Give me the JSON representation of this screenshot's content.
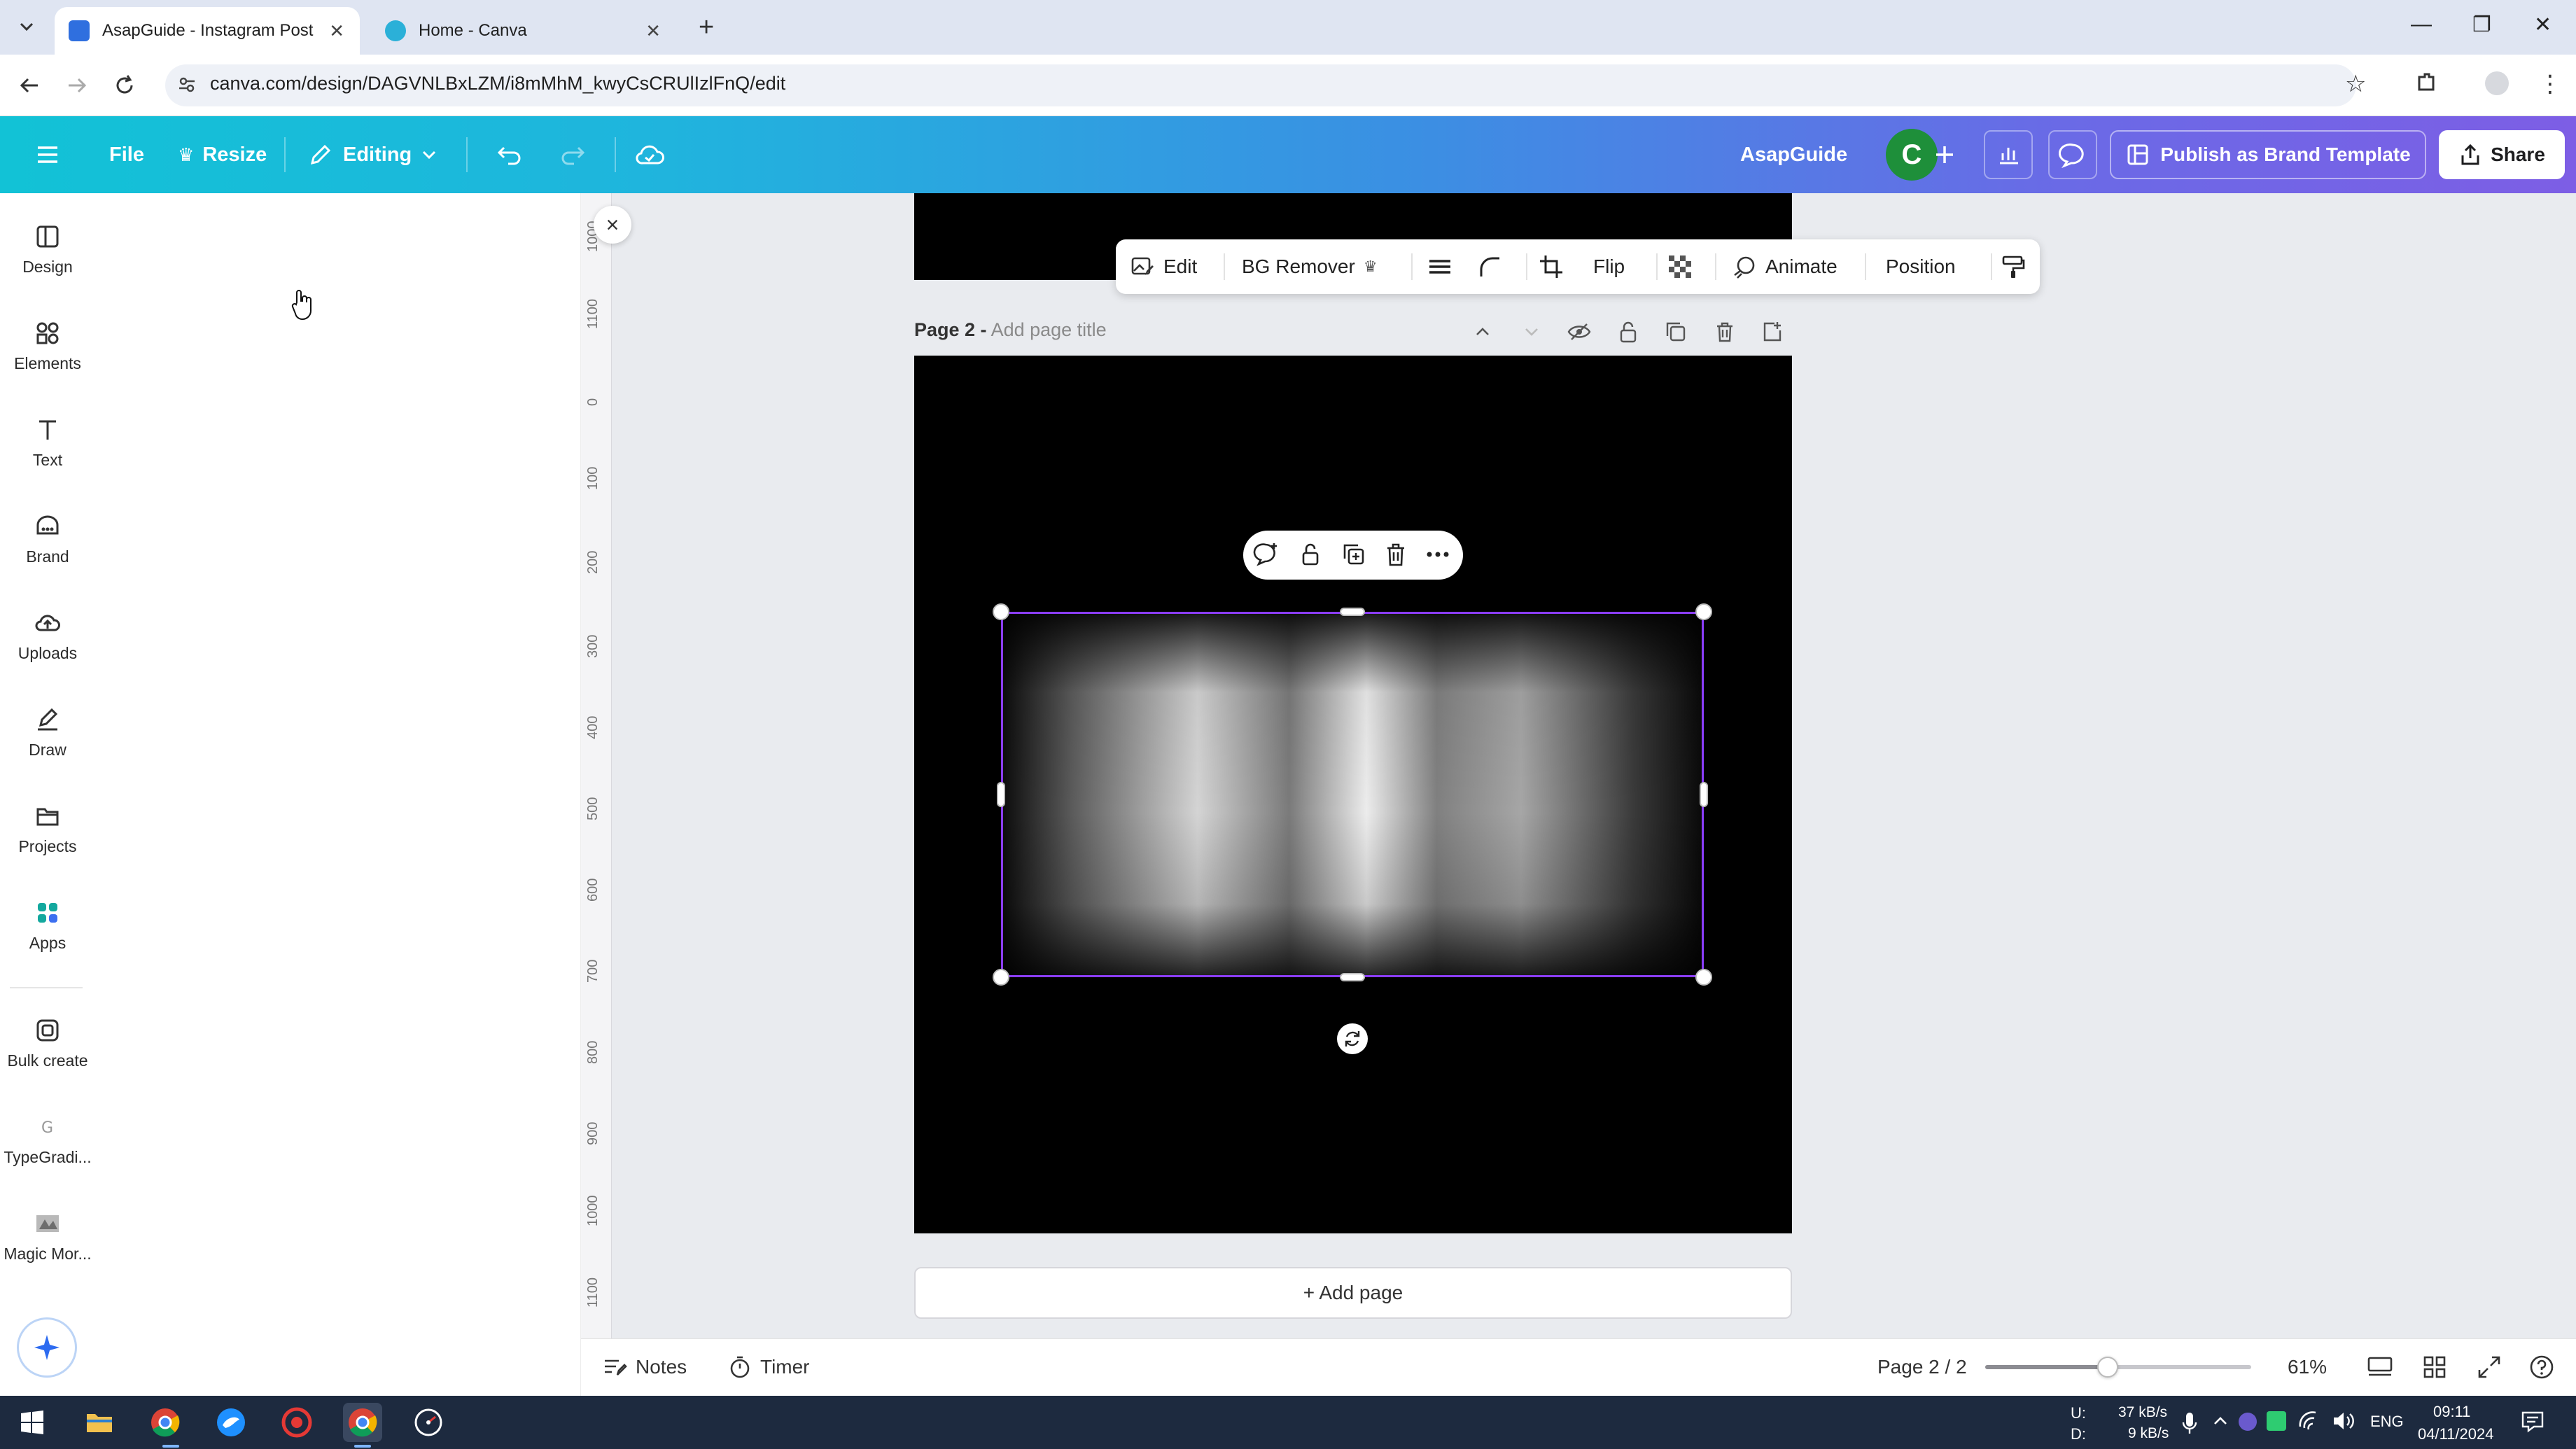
{
  "browser": {
    "tabs": [
      {
        "title": "AsapGuide - Instagram Post",
        "active": true
      },
      {
        "title": "Home - Canva",
        "active": false
      }
    ],
    "url": "canva.com/design/DAGVNLBxLZM/i8mMhM_kwyCsCRUlIzlFnQ/edit"
  },
  "header": {
    "file_label": "File",
    "resize_label": "Resize",
    "editing_label": "Editing",
    "team_name": "AsapGuide",
    "avatar_initial": "C",
    "publish_label": "Publish as Brand Template",
    "share_label": "Share"
  },
  "rail": {
    "items": [
      {
        "label": "Design",
        "icon": "layout-icon"
      },
      {
        "label": "Elements",
        "icon": "shapes-icon"
      },
      {
        "label": "Text",
        "icon": "text-icon"
      },
      {
        "label": "Brand",
        "icon": "brand-icon"
      },
      {
        "label": "Uploads",
        "icon": "cloud-upload-icon"
      },
      {
        "label": "Draw",
        "icon": "pen-icon"
      },
      {
        "label": "Projects",
        "icon": "folder-icon"
      },
      {
        "label": "Apps",
        "icon": "apps-icon"
      },
      {
        "label": "Bulk create",
        "icon": "bulk-create-icon"
      },
      {
        "label": "TypeGradi...",
        "icon": "typegradient-icon"
      },
      {
        "label": "Magic Mor...",
        "icon": "magic-morph-icon"
      }
    ]
  },
  "ruler": {
    "ticks": [
      "1000",
      "1100",
      "0",
      "100",
      "200",
      "300",
      "400",
      "500",
      "600",
      "700",
      "800",
      "900",
      "1000",
      "1100"
    ]
  },
  "image_toolbar": {
    "edit_label": "Edit",
    "bg_remover_label": "BG Remover",
    "flip_label": "Flip",
    "animate_label": "Animate",
    "position_label": "Position"
  },
  "page": {
    "label": "Page 2 -",
    "title_placeholder": "Add page title",
    "add_page_label": "+ Add page"
  },
  "bottom": {
    "notes_label": "Notes",
    "timer_label": "Timer",
    "page_indicator": "Page 2 / 2",
    "zoom_label": "61%",
    "zoom_fraction": 0.61
  },
  "taskbar": {
    "net_up": "37 kB/s",
    "net_down": "9 kB/s",
    "net_up_label": "U:",
    "net_down_label": "D:",
    "language": "ENG",
    "time": "09:11",
    "date": "04/11/2024"
  },
  "colors": {
    "selection": "#8b3dff",
    "avatar": "#1e8f3a",
    "apps_accent": "#13a89e"
  }
}
